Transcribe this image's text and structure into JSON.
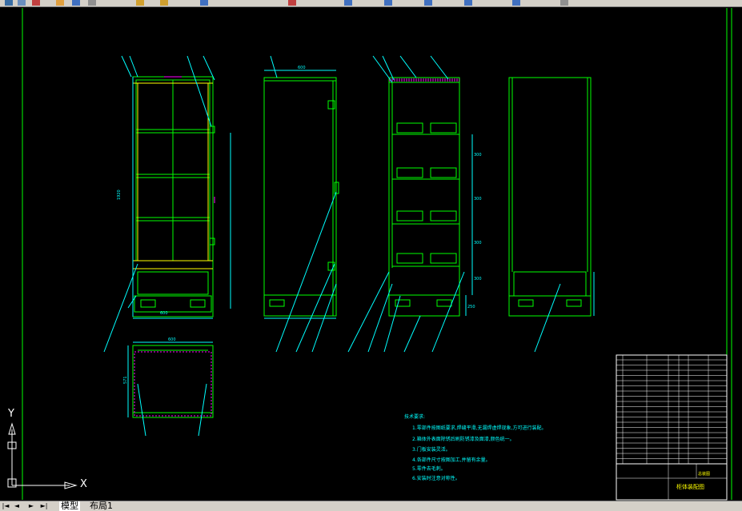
{
  "tabs": [
    {
      "label": "模型"
    },
    {
      "label": "布局1"
    }
  ],
  "ucs": {
    "x_label": "X",
    "y_label": "Y"
  },
  "drawing": {
    "front_width": "600",
    "front_height": "1920",
    "side_depth": "600",
    "top_width": "600",
    "top_depth": "571",
    "dims_right": [
      "500",
      "504",
      "595"
    ],
    "dims_section": [
      "300",
      "300",
      "300",
      "300",
      "250"
    ]
  },
  "notes": {
    "title": "技术要求:",
    "items": [
      "1.零部件按图纸要求,焊缝平滑,无漏焊虚焊现象,方可进行装配。",
      "2.箱体外表面除锈后刷防锈漆及面漆,颜色统一。",
      "3.门板安装灵活。",
      "4.各部件尺寸按图加工,并留有余量。",
      "5.零件去毛刺。",
      "6.安装时注意对称性。"
    ]
  },
  "title_block": {
    "name": "柜体装配图",
    "subtitle": "总装图"
  },
  "colors": {
    "line": "#00ff00",
    "dim": "#00ffff",
    "yellow": "#ffff00",
    "magenta": "#ff00ff",
    "white": "#ffffff"
  }
}
